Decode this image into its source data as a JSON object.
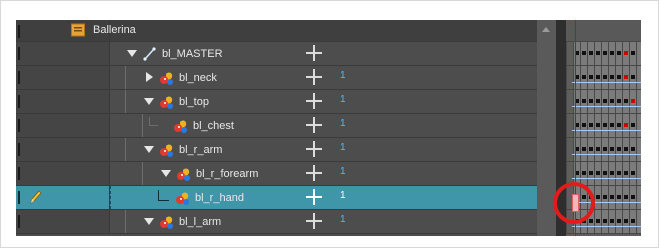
{
  "header": {
    "title": "Ballerina",
    "folder_icon": "folder-icon"
  },
  "layers": [
    {
      "name": "bl_MASTER",
      "icon": "peg-icon",
      "expander": "expanded",
      "number": "",
      "selected": false
    },
    {
      "name": "bl_neck",
      "icon": "drawing-layer-icon",
      "expander": "collapsed",
      "number": "1",
      "selected": false
    },
    {
      "name": "bl_top",
      "icon": "drawing-layer-icon",
      "expander": "expanded",
      "number": "1",
      "selected": false
    },
    {
      "name": "bl_chest",
      "icon": "drawing-layer-icon",
      "expander": "none",
      "number": "1",
      "selected": false
    },
    {
      "name": "bl_r_arm",
      "icon": "drawing-layer-icon",
      "expander": "expanded",
      "number": "1",
      "selected": false
    },
    {
      "name": "bl_r_forearm",
      "icon": "drawing-layer-icon",
      "expander": "expanded",
      "number": "1",
      "selected": false
    },
    {
      "name": "bl_r_hand",
      "icon": "drawing-layer-icon",
      "expander": "none",
      "number": "1",
      "selected": true
    },
    {
      "name": "bl_l_arm",
      "icon": "drawing-layer-icon",
      "expander": "expanded",
      "number": "1",
      "selected": false
    }
  ],
  "colors": {
    "panel_bg": "#4d4d4d",
    "selected_row": "#3e96a8",
    "number_text": "#56b4ff",
    "playhead": "#e00000",
    "annotation_circle": "#e41b1b"
  },
  "annotation": {
    "shape": "circle",
    "target": "selected-frame-cell"
  }
}
